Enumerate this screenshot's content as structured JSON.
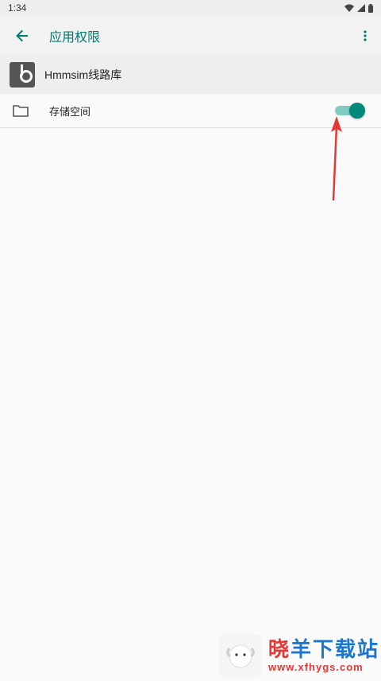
{
  "status_bar": {
    "time": "1:34"
  },
  "app_bar": {
    "title": "应用权限"
  },
  "app_header": {
    "name": "Hmmsim线路库"
  },
  "permission": {
    "label": "存储空间",
    "enabled": true
  },
  "watermark": {
    "title_part1": "晓",
    "title_part2": "羊下载站",
    "url": "www.xfhygs.com"
  },
  "colors": {
    "accent": "#00796b",
    "switch_thumb": "#00897b",
    "switch_track": "#80cbc4",
    "arrow": "#e53935"
  }
}
